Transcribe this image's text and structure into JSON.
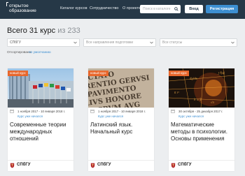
{
  "header": {
    "logo_line1": "открытое",
    "logo_line2": "образование",
    "nav": [
      "Каталог курсов",
      "Сотрудничество",
      "О проекте"
    ],
    "search_placeholder": "Поиск в каталоге",
    "login_label": "Вход",
    "register_label": "Регистрация"
  },
  "filters": {
    "total_prefix": "Всего 31 курс",
    "total_suffix": "из 233",
    "university_value": "СПбГУ",
    "direction_placeholder": "Все направления подготовки",
    "status_placeholder": "Все статусы",
    "sort_label": "Отсортировано:",
    "sort_value": "по умолчанию"
  },
  "colors": {
    "header_bg": "#263847",
    "accent": "#3d8fd1",
    "badge": "#e8672c",
    "page_bg": "#eceef0"
  },
  "cards": [
    {
      "badge": "новый курс",
      "dates": "1 ноября 2017 - 10 января 2018 г.",
      "status": "Курс уже начался",
      "title": "Современные теории международных отношений",
      "university": "СПбГУ"
    },
    {
      "badge": "новый курс",
      "dates": "1 ноября 2017 - 10 января 2018 г.",
      "status": "Курс уже начался",
      "title": "Латинский язык. Начальный курс",
      "university": "СПбГУ"
    },
    {
      "badge": "новый курс",
      "dates": "30 октября - 25 декабря 2017 г.",
      "status": "Курс уже начался",
      "title": "Математические методы в психологии. Основы применения",
      "university": "СПбГУ"
    }
  ]
}
